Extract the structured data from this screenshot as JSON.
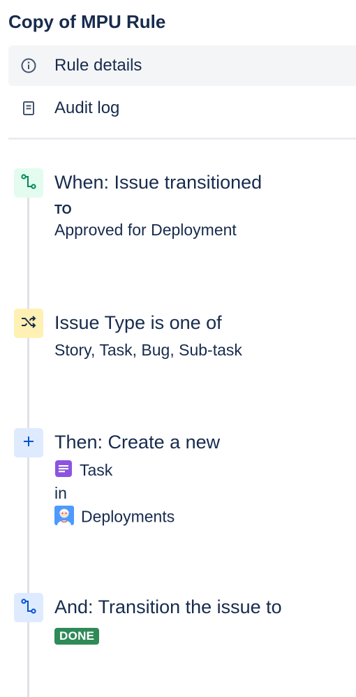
{
  "page": {
    "title": "Copy of MPU Rule"
  },
  "nav": {
    "items": [
      {
        "label": "Rule details",
        "icon": "info-icon",
        "active": true
      },
      {
        "label": "Audit log",
        "icon": "document-icon",
        "active": false
      }
    ]
  },
  "steps": [
    {
      "kind": "trigger",
      "icon": "transition-icon",
      "badge_color": "#e3fcef",
      "icon_color": "#00875a",
      "title": "When: Issue transitioned",
      "label": "TO",
      "value": "Approved for Deployment"
    },
    {
      "kind": "condition",
      "icon": "shuffle-icon",
      "badge_color": "#fff0b3",
      "icon_color": "#172b4d",
      "title": "Issue Type is one of",
      "value": "Story, Task, Bug, Sub-task"
    },
    {
      "kind": "action",
      "icon": "plus-icon",
      "badge_color": "#deebff",
      "icon_color": "#0052cc",
      "title": "Then: Create a new",
      "issue_type": "Task",
      "issue_type_icon": "task-icon",
      "connector": "in",
      "project": "Deployments",
      "project_icon": "project-avatar-icon"
    },
    {
      "kind": "action",
      "icon": "transition-icon",
      "badge_color": "#deebff",
      "icon_color": "#0052cc",
      "title": "And: Transition the issue to",
      "status": "DONE",
      "status_color": "#2e8a57"
    }
  ]
}
